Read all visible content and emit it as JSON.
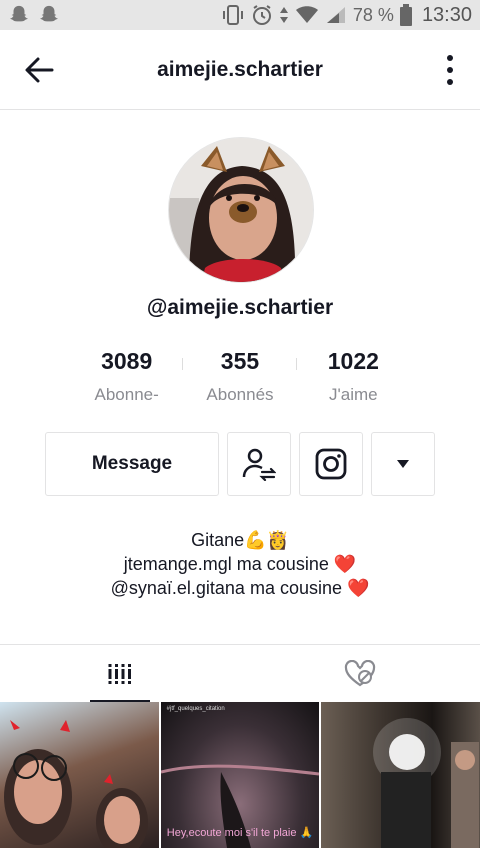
{
  "status_bar": {
    "battery_percent": "78 %",
    "time": "13:30",
    "icons": [
      "snapchat-ghost-icon",
      "snapchat-ghost-icon",
      "vibrate-icon",
      "alarm-icon",
      "data-arrows-icon",
      "wifi-icon",
      "signal-icon",
      "battery-icon"
    ]
  },
  "header": {
    "title": "aimejie.schartier",
    "back_icon": "arrow-left-icon",
    "menu_icon": "more-vertical-icon"
  },
  "profile": {
    "handle": "@aimejie.schartier",
    "stats": [
      {
        "value": "3089",
        "label": "Abonne-"
      },
      {
        "value": "355",
        "label": "Abonnés"
      },
      {
        "value": "1022",
        "label": "J'aime"
      }
    ],
    "buttons": {
      "message_label": "Message",
      "follow_icon": "user-swap-icon",
      "instagram_icon": "instagram-icon",
      "dropdown_icon": "caret-down-icon"
    },
    "bio": [
      "Gitane💪👸",
      "jtemange.mgl ma cousine ❤️",
      "@synaï.el.gitana ma cousine ❤️"
    ]
  },
  "tabs": {
    "videos_icon": "grid-bars-icon",
    "liked_icon": "heart-hidden-icon"
  },
  "videos": [
    {
      "caption": ""
    },
    {
      "caption": "Hey,ecoute moi s'il te plaie 🙏",
      "top_caption": "#jtf_quelques_citation"
    },
    {
      "caption": ""
    }
  ],
  "colors": {
    "accent_text": "#161823",
    "muted": "#8a8b91",
    "heart": "#e1243a"
  }
}
